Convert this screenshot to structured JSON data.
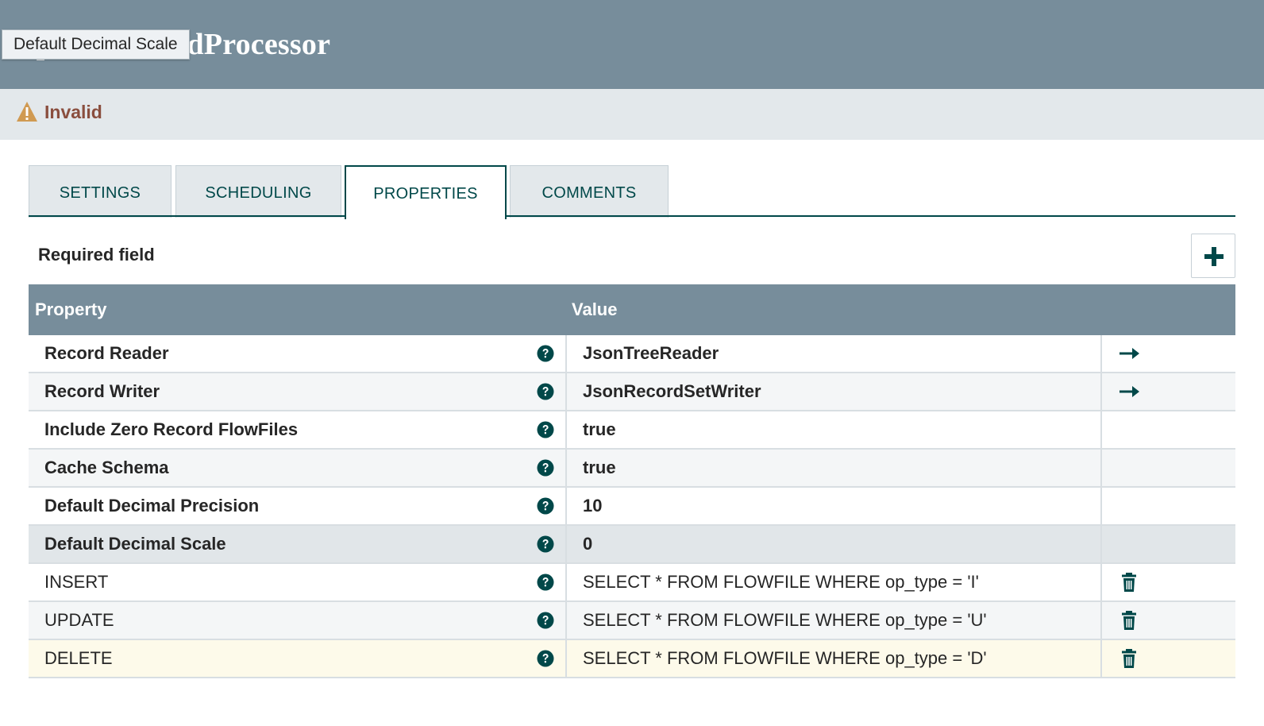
{
  "header": {
    "title": "UpdateRecordProcessor",
    "tooltip": "Default Decimal Scale"
  },
  "status": {
    "icon": "warning-icon",
    "text": "Invalid"
  },
  "tabs": [
    {
      "label": "SETTINGS",
      "selected": false
    },
    {
      "label": "SCHEDULING",
      "selected": false
    },
    {
      "label": "PROPERTIES",
      "selected": true
    },
    {
      "label": "COMMENTS",
      "selected": false
    }
  ],
  "properties_panel": {
    "required_label": "Required field",
    "add_button_icon": "plus-icon",
    "columns": {
      "property": "Property",
      "value": "Value"
    },
    "rows": [
      {
        "property": "Record Reader",
        "value": "JsonTreeReader",
        "required": true,
        "action": "go-to-arrow-icon"
      },
      {
        "property": "Record Writer",
        "value": "JsonRecordSetWriter",
        "required": true,
        "action": "go-to-arrow-icon"
      },
      {
        "property": "Include Zero Record FlowFiles",
        "value": "true",
        "required": true,
        "action": ""
      },
      {
        "property": "Cache Schema",
        "value": "true",
        "required": true,
        "action": ""
      },
      {
        "property": "Default Decimal Precision",
        "value": "10",
        "required": true,
        "action": ""
      },
      {
        "property": "Default Decimal Scale",
        "value": "0",
        "required": true,
        "action": ""
      },
      {
        "property": "INSERT",
        "value": "SELECT * FROM FLOWFILE WHERE op_type = 'I'",
        "required": false,
        "action": "trash-icon"
      },
      {
        "property": "UPDATE",
        "value": "SELECT * FROM FLOWFILE WHERE op_type = 'U'",
        "required": false,
        "action": "trash-icon"
      },
      {
        "property": "DELETE",
        "value": "SELECT * FROM FLOWFILE WHERE op_type = 'D'",
        "required": false,
        "action": "trash-icon"
      }
    ]
  },
  "colors": {
    "header_bg": "#778d9b",
    "accent": "#004849",
    "status_text": "#8a4e3e",
    "warning": "#d09a52",
    "selected_row": "#fdfaea"
  }
}
